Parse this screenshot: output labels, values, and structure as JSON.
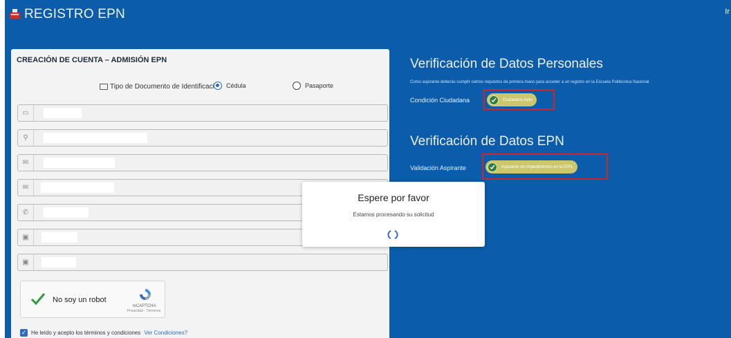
{
  "header": {
    "title": "REGISTRO EPN",
    "corner_text": "Ir"
  },
  "form": {
    "title": "CREACIÓN DE CUENTA – ADMISIÓN EPN",
    "doc_type_label": "Tipo de Documento de Identificación",
    "doc_options": [
      {
        "label": "Cédula",
        "selected": true
      },
      {
        "label": "Pasaporte",
        "selected": false
      }
    ],
    "fields": [
      {
        "icon": "id-card-icon"
      },
      {
        "icon": "user-icon"
      },
      {
        "icon": "email-icon"
      },
      {
        "icon": "email-icon"
      },
      {
        "icon": "phone-icon"
      },
      {
        "icon": "calendar-icon"
      },
      {
        "icon": "calendar-icon"
      }
    ],
    "captcha": {
      "label": "No soy un robot",
      "brand": "reCAPTCHA",
      "links": "Privacidad - Términos",
      "checked": true
    },
    "terms": {
      "text": "He leído y acepto los términos y condiciones",
      "link": "Ver Condiciones?",
      "checked": true
    }
  },
  "verification": {
    "personal_title": "Verificación de Datos Personales",
    "personal_subtitle": "Como aspirante deberás cumplir ciertos requisitos de primera mano para acceder a un registro en la Escuela Politécnica Nacional",
    "condition_label": "Condición Ciudadana",
    "condition_status": "Ciudadano Apto",
    "epn_title": "Verificación de Datos EPN",
    "validation_label": "Validación Aspirante",
    "validation_status": "Aspirante sin impedimentos en la EPN."
  },
  "modal": {
    "title": "Espere por favor",
    "message": "Estamos procesando su solicitud"
  },
  "colors": {
    "background": "#0b5cab",
    "highlight_border": "#d0242c",
    "status_pill": "#ccc76a",
    "accent": "#2d6cc0"
  }
}
